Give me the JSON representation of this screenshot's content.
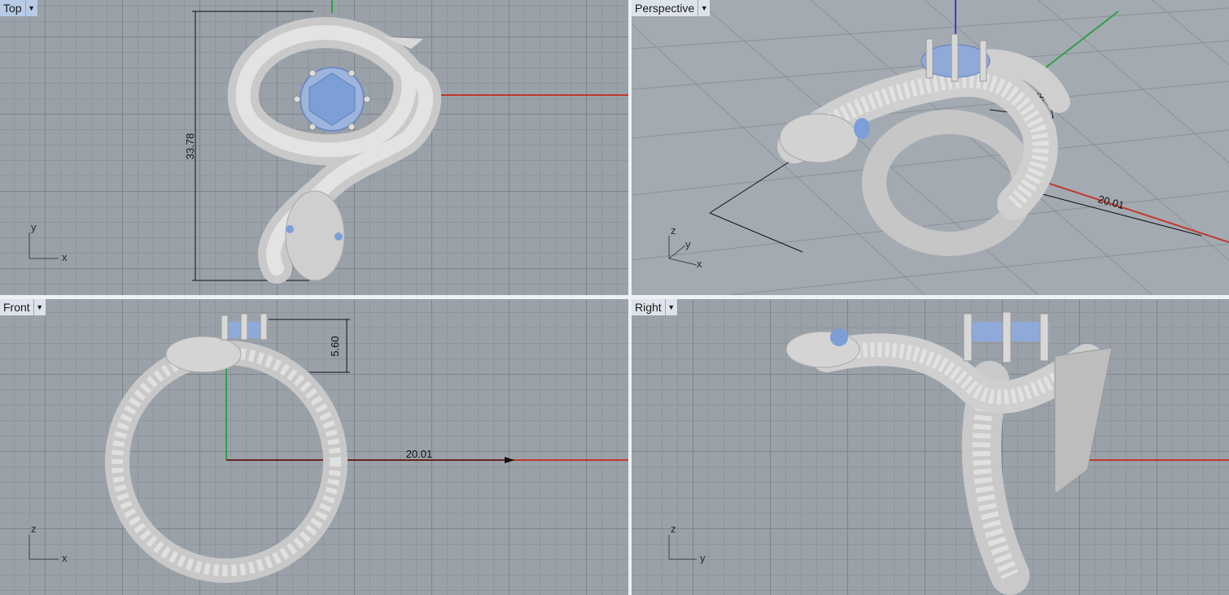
{
  "viewports": {
    "top": {
      "title": "Top",
      "dimension": "33.78",
      "axis_h": "x",
      "axis_v": "y"
    },
    "perspective": {
      "title": "Perspective",
      "dimension_height": "5.60",
      "dimension_width": "20.01",
      "axis_1": "z",
      "axis_2": "y",
      "axis_3": "x"
    },
    "front": {
      "title": "Front",
      "dimension_height": "5.60",
      "dimension_width": "20.01",
      "axis_h": "x",
      "axis_v": "z"
    },
    "right": {
      "title": "Right",
      "axis_h": "y",
      "axis_v": "z"
    }
  },
  "dropdown_glyph": "▼",
  "colors": {
    "x_axis": "#c0392b",
    "y_axis": "#2ea043",
    "z_axis": "#3b3bd6",
    "gem": "#7d9fd8",
    "metal": "#d2d2d2"
  }
}
